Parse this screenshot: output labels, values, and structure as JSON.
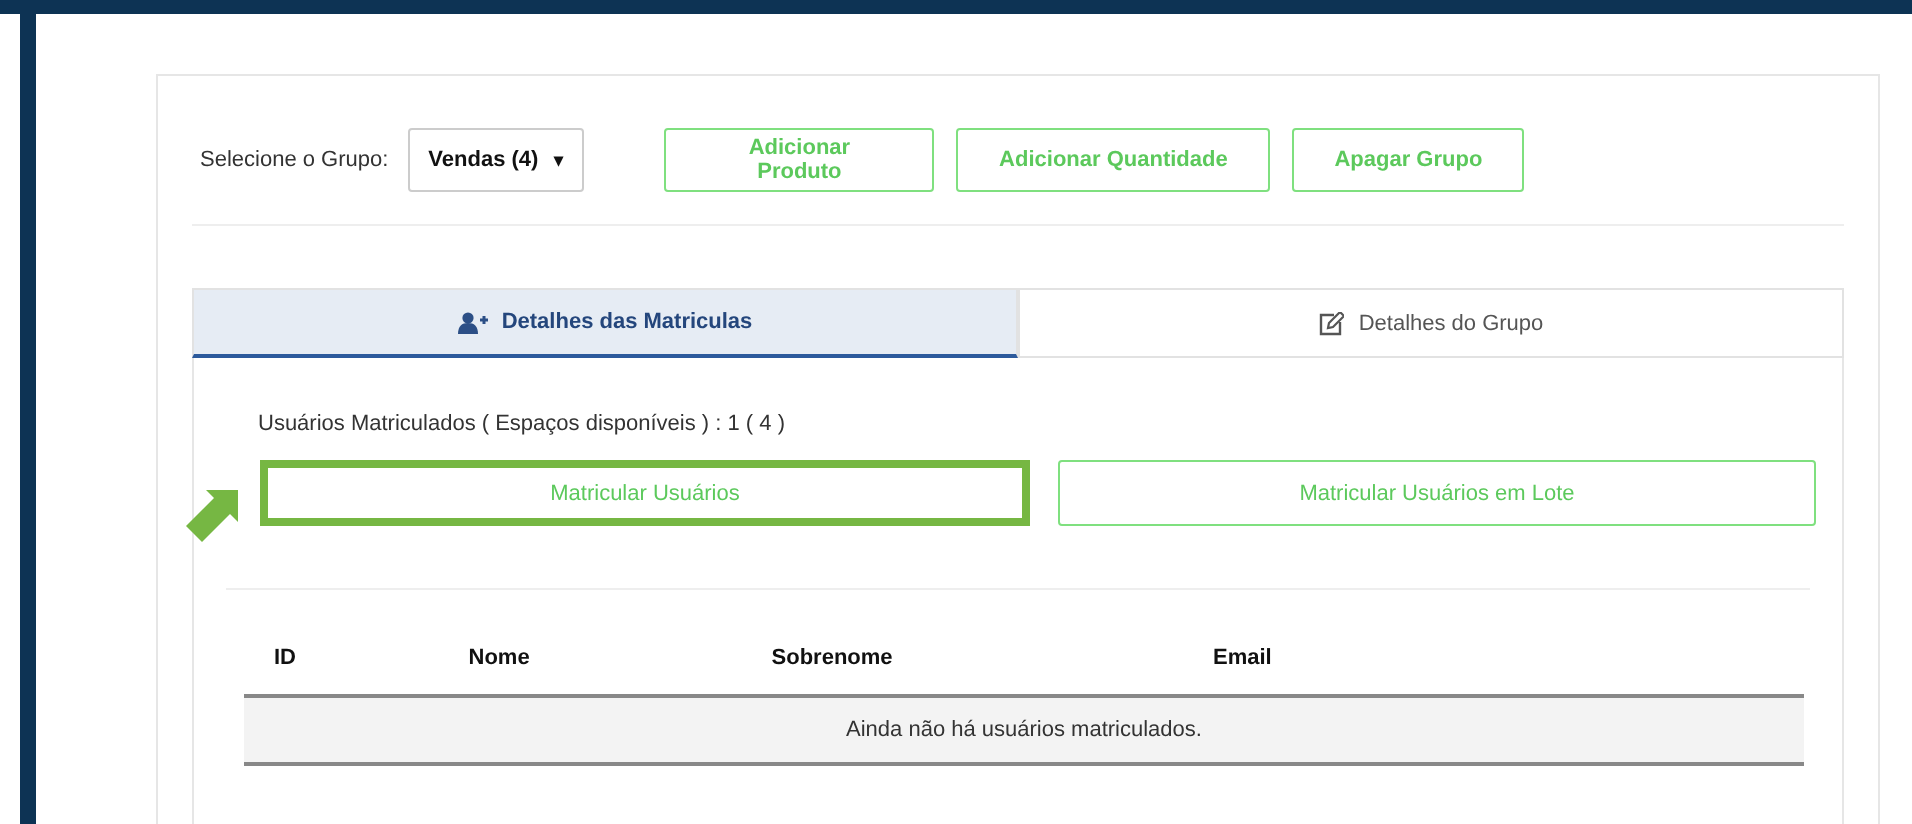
{
  "toolbar": {
    "group_label": "Selecione o Grupo:",
    "group_select": {
      "value": "Vendas (4)",
      "caret": "▾"
    },
    "buttons": [
      "Adicionar Produto",
      "Adicionar Quantidade",
      "Apagar Grupo"
    ]
  },
  "tabs": [
    {
      "label": "Detalhes das Matriculas",
      "kind": "users",
      "selected": true
    },
    {
      "label": "Detalhes do Grupo",
      "kind": "edit",
      "selected": false
    }
  ],
  "enrollment": {
    "summary": "Usuários Matriculados ( Espaços disponíveis ) : 1 ( 4 )",
    "buttons": [
      {
        "label": "Matricular Usuários",
        "highlighted": true
      },
      {
        "label": "Matricular Usuários em Lote",
        "highlighted": false
      }
    ]
  },
  "table": {
    "columns": [
      "ID",
      "Nome",
      "Sobrenome",
      "Email"
    ],
    "empty_message": "Ainda não há usuários matriculados."
  }
}
